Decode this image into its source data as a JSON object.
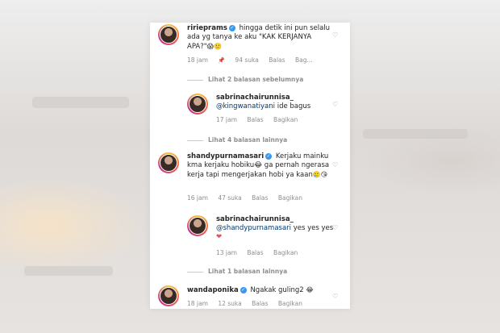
{
  "comments": [
    {
      "username": "ririeprams",
      "text": "hingga detik ini pun selalu ada yg tanya ke aku \"KAK KERJANYA APA?\"",
      "emoji": "😱🙂",
      "time": "18 jam",
      "pin_icon": "📌",
      "likes": "94 suka",
      "reply": "Balas",
      "share": "Bag..."
    },
    {
      "username": "sabrinachairunnisa_",
      "mention": "@kingwanatiyani",
      "text": "ide bagus",
      "time": "17 jam",
      "reply": "Balas",
      "share": "Bagikan"
    },
    {
      "username": "shandypurnamasari",
      "text": "Kerjaku mainku kma kerjaku hobiku😂 ga pernah ngerasa kerja tapi mengerjakan hobi ya kaan",
      "emoji": "🥲😘",
      "time": "16 jam",
      "likes": "47 suka",
      "reply": "Balas",
      "share": "Bagikan"
    },
    {
      "username": "sabrinachairunnisa_",
      "mention": "@shandypurnamasari",
      "text": "yes yes yes",
      "emoji": "❤",
      "time": "13 jam",
      "reply": "Balas",
      "share": "Bagikan"
    },
    {
      "username": "wandaponika",
      "text": "Ngakak guling2",
      "emoji": "😂",
      "time": "18 jam",
      "likes": "12 suka",
      "reply": "Balas",
      "share": "Bagikan"
    }
  ],
  "replies_links": {
    "previous": "Lihat 2 balasan sebelumnya",
    "four_more": "Lihat 4 balasan lainnya",
    "one_more": "Lihat 1 balasan lainnya"
  },
  "icons": {
    "verified": "✓",
    "heart": "♡"
  }
}
